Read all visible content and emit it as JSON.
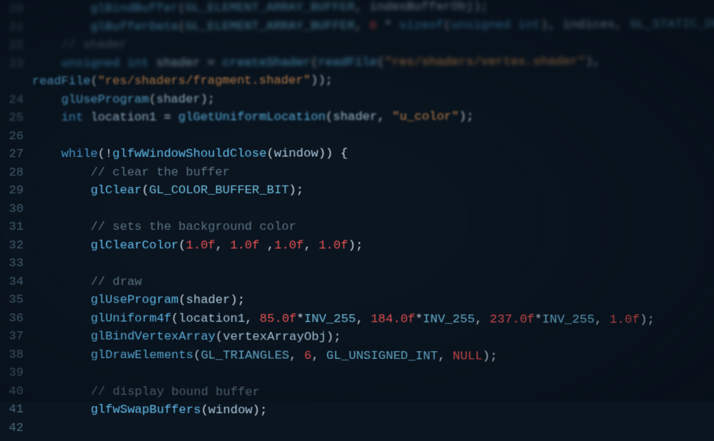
{
  "lineNumbers": [
    "20",
    "21",
    "22",
    "23",
    "24",
    "25",
    "26",
    "27",
    "28",
    "29",
    "30",
    "31",
    "32",
    "33",
    "34",
    "35",
    "36",
    "37",
    "38",
    "39",
    "40",
    "41",
    "42"
  ],
  "code": {
    "l20": {
      "indent": "        ",
      "tokens": [
        {
          "t": "glBindBuffer",
          "c": "fn"
        },
        {
          "t": "(",
          "c": "paren"
        },
        {
          "t": "GL_ELEMENT_ARRAY_BUFFER",
          "c": "const"
        },
        {
          "t": ", ",
          "c": "punct"
        },
        {
          "t": "indexBufferObj",
          "c": "var"
        },
        {
          "t": ");",
          "c": "punct"
        }
      ]
    },
    "l21": {
      "indent": "        ",
      "tokens": [
        {
          "t": "glBufferData",
          "c": "fn"
        },
        {
          "t": "(",
          "c": "paren"
        },
        {
          "t": "GL_ELEMENT_ARRAY_BUFFER",
          "c": "const"
        },
        {
          "t": ", ",
          "c": "punct"
        },
        {
          "t": "6",
          "c": "num"
        },
        {
          "t": " * ",
          "c": "op"
        },
        {
          "t": "sizeof",
          "c": "kw"
        },
        {
          "t": "(",
          "c": "paren"
        },
        {
          "t": "unsigned int",
          "c": "type"
        },
        {
          "t": "), ",
          "c": "punct"
        },
        {
          "t": "indices",
          "c": "var"
        },
        {
          "t": ", ",
          "c": "punct"
        },
        {
          "t": "GL_STATIC_DRAW",
          "c": "const"
        },
        {
          "t": ");",
          "c": "punct"
        }
      ]
    },
    "l22": {
      "indent": "    ",
      "tokens": [
        {
          "t": "// shader",
          "c": "comment"
        }
      ]
    },
    "l23a": {
      "indent": "    ",
      "tokens": [
        {
          "t": "unsigned int",
          "c": "type"
        },
        {
          "t": " ",
          "c": "op"
        },
        {
          "t": "shader",
          "c": "var"
        },
        {
          "t": " = ",
          "c": "op"
        },
        {
          "t": "createShader",
          "c": "fn"
        },
        {
          "t": "(",
          "c": "paren"
        },
        {
          "t": "readFile",
          "c": "fn"
        },
        {
          "t": "(",
          "c": "paren"
        },
        {
          "t": "\"res/shaders/vertex.shader\"",
          "c": "str"
        },
        {
          "t": "),",
          "c": "punct"
        }
      ]
    },
    "l23b": {
      "indent": "",
      "tokens": [
        {
          "t": "readFile",
          "c": "fn"
        },
        {
          "t": "(",
          "c": "paren"
        },
        {
          "t": "\"res/shaders/fragment.shader\"",
          "c": "str"
        },
        {
          "t": "));",
          "c": "punct"
        }
      ]
    },
    "l24": {
      "indent": "    ",
      "tokens": [
        {
          "t": "glUseProgram",
          "c": "fn"
        },
        {
          "t": "(",
          "c": "paren"
        },
        {
          "t": "shader",
          "c": "var"
        },
        {
          "t": ");",
          "c": "punct"
        }
      ]
    },
    "l25": {
      "indent": "    ",
      "tokens": [
        {
          "t": "int",
          "c": "type"
        },
        {
          "t": " ",
          "c": "op"
        },
        {
          "t": "location1",
          "c": "var"
        },
        {
          "t": " = ",
          "c": "op"
        },
        {
          "t": "glGetUniformLocation",
          "c": "fn"
        },
        {
          "t": "(",
          "c": "paren"
        },
        {
          "t": "shader",
          "c": "var"
        },
        {
          "t": ", ",
          "c": "punct"
        },
        {
          "t": "\"u_color\"",
          "c": "str"
        },
        {
          "t": ");",
          "c": "punct"
        }
      ]
    },
    "l26": {
      "indent": "",
      "tokens": []
    },
    "l27": {
      "indent": "    ",
      "tokens": [
        {
          "t": "while",
          "c": "kw"
        },
        {
          "t": "(!",
          "c": "paren"
        },
        {
          "t": "glfwWindowShouldClose",
          "c": "fn"
        },
        {
          "t": "(",
          "c": "paren"
        },
        {
          "t": "window",
          "c": "var"
        },
        {
          "t": ")) {",
          "c": "punct"
        }
      ]
    },
    "l28": {
      "indent": "        ",
      "tokens": [
        {
          "t": "// clear the buffer",
          "c": "comment"
        }
      ]
    },
    "l29": {
      "indent": "        ",
      "tokens": [
        {
          "t": "glClear",
          "c": "fn"
        },
        {
          "t": "(",
          "c": "paren"
        },
        {
          "t": "GL_COLOR_BUFFER_BIT",
          "c": "const"
        },
        {
          "t": ");",
          "c": "punct"
        }
      ]
    },
    "l30": {
      "indent": "",
      "tokens": []
    },
    "l31": {
      "indent": "        ",
      "tokens": [
        {
          "t": "// sets the background color",
          "c": "comment"
        }
      ]
    },
    "l32": {
      "indent": "        ",
      "tokens": [
        {
          "t": "glClearColor",
          "c": "fn"
        },
        {
          "t": "(",
          "c": "paren"
        },
        {
          "t": "1.0f",
          "c": "num"
        },
        {
          "t": ", ",
          "c": "punct"
        },
        {
          "t": "1.0f",
          "c": "num"
        },
        {
          "t": " ,",
          "c": "punct"
        },
        {
          "t": "1.0f",
          "c": "num"
        },
        {
          "t": ", ",
          "c": "punct"
        },
        {
          "t": "1.0f",
          "c": "num"
        },
        {
          "t": ");",
          "c": "punct"
        }
      ]
    },
    "l33": {
      "indent": "",
      "tokens": []
    },
    "l34": {
      "indent": "        ",
      "tokens": [
        {
          "t": "// draw",
          "c": "comment"
        }
      ]
    },
    "l35": {
      "indent": "        ",
      "tokens": [
        {
          "t": "glUseProgram",
          "c": "fn"
        },
        {
          "t": "(",
          "c": "paren"
        },
        {
          "t": "shader",
          "c": "var"
        },
        {
          "t": ");",
          "c": "punct"
        }
      ]
    },
    "l36": {
      "indent": "        ",
      "tokens": [
        {
          "t": "glUniform4f",
          "c": "fn"
        },
        {
          "t": "(",
          "c": "paren"
        },
        {
          "t": "location1",
          "c": "var"
        },
        {
          "t": ", ",
          "c": "punct"
        },
        {
          "t": "85.0f",
          "c": "num"
        },
        {
          "t": "*",
          "c": "op"
        },
        {
          "t": "INV_255",
          "c": "const"
        },
        {
          "t": ", ",
          "c": "punct"
        },
        {
          "t": "184.0f",
          "c": "num"
        },
        {
          "t": "*",
          "c": "op"
        },
        {
          "t": "INV_255",
          "c": "const"
        },
        {
          "t": ", ",
          "c": "punct"
        },
        {
          "t": "237.0f",
          "c": "num"
        },
        {
          "t": "*",
          "c": "op"
        },
        {
          "t": "INV_255",
          "c": "const"
        },
        {
          "t": ", ",
          "c": "punct"
        },
        {
          "t": "1.0f",
          "c": "num"
        },
        {
          "t": ");",
          "c": "punct"
        }
      ]
    },
    "l37": {
      "indent": "        ",
      "tokens": [
        {
          "t": "glBindVertexArray",
          "c": "fn"
        },
        {
          "t": "(",
          "c": "paren"
        },
        {
          "t": "vertexArrayObj",
          "c": "var"
        },
        {
          "t": ");",
          "c": "punct"
        }
      ]
    },
    "l38": {
      "indent": "        ",
      "tokens": [
        {
          "t": "glDrawElements",
          "c": "fn"
        },
        {
          "t": "(",
          "c": "paren"
        },
        {
          "t": "GL_TRIANGLES",
          "c": "const"
        },
        {
          "t": ", ",
          "c": "punct"
        },
        {
          "t": "6",
          "c": "num"
        },
        {
          "t": ", ",
          "c": "punct"
        },
        {
          "t": "GL_UNSIGNED_INT",
          "c": "const"
        },
        {
          "t": ", ",
          "c": "punct"
        },
        {
          "t": "NULL",
          "c": "null"
        },
        {
          "t": ");",
          "c": "punct"
        }
      ]
    },
    "l39": {
      "indent": "",
      "tokens": []
    },
    "l40": {
      "indent": "        ",
      "tokens": [
        {
          "t": "// display bound buffer",
          "c": "comment"
        }
      ]
    },
    "l41": {
      "indent": "        ",
      "tokens": [
        {
          "t": "glfwSwapBuffers",
          "c": "fn"
        },
        {
          "t": "(",
          "c": "paren"
        },
        {
          "t": "window",
          "c": "var"
        },
        {
          "t": ");",
          "c": "punct"
        }
      ]
    },
    "l42": {
      "indent": "",
      "tokens": []
    }
  },
  "lineOrder": [
    "l20",
    "l21",
    "l22",
    "l23a",
    "l23b",
    "l24",
    "l25",
    "l26",
    "l27",
    "l28",
    "l29",
    "l30",
    "l31",
    "l32",
    "l33",
    "l34",
    "l35",
    "l36",
    "l37",
    "l38",
    "l39",
    "l40",
    "l41",
    "l42"
  ],
  "blurClasses": {
    "l20": "blur-top",
    "l21": "blur-top",
    "l22": "blur-top",
    "l23a": "blur-top",
    "l23b": "blur-mid",
    "l24": "blur-mid",
    "l25": "blur-mid",
    "l26": "",
    "l27": "",
    "l28": "",
    "l29": "",
    "l30": "",
    "l31": "",
    "l32": "",
    "l33": "",
    "l34": "",
    "l35": "",
    "l36": "",
    "l37": "",
    "l38": "",
    "l39": "",
    "l40": "",
    "l41": "",
    "l42": ""
  }
}
